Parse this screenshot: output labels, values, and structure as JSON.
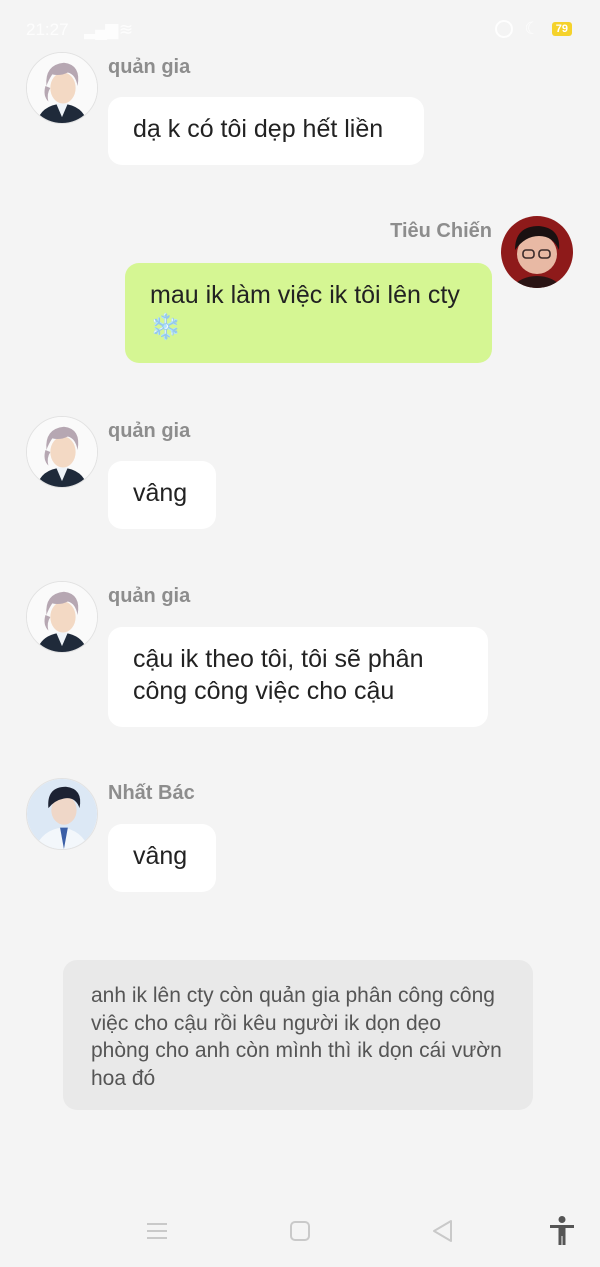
{
  "status_bar": {
    "time": "21:27",
    "battery": "79"
  },
  "messages": [
    {
      "sender": "quản gia",
      "text": "dạ k có tôi dẹp hết liền"
    },
    {
      "sender": "Tiêu Chiến",
      "text": "mau ik làm việc ik tôi lên cty ❄️"
    },
    {
      "sender": "quản gia",
      "text": "vâng"
    },
    {
      "sender": "quản gia",
      "text": "cậu ik theo tôi, tôi sẽ phân công công việc cho cậu"
    },
    {
      "sender": "Nhất Bác",
      "text": "vâng"
    }
  ],
  "narration": "anh ik lên cty còn quản gia phân công công việc cho cậu rồi kêu người ik dọn dẹo phòng cho anh còn mình thì ik dọn cái vườn hoa đó",
  "nav": {
    "icons": [
      "menu-icon",
      "home-square-icon",
      "back-triangle-icon",
      "accessibility-icon"
    ]
  },
  "colors": {
    "background": "#f4f4f4",
    "bubble": "#ffffff",
    "bubble_self": "#d5f693",
    "narration_bg": "#e9e9e9",
    "sender": "#8d8d8d"
  }
}
